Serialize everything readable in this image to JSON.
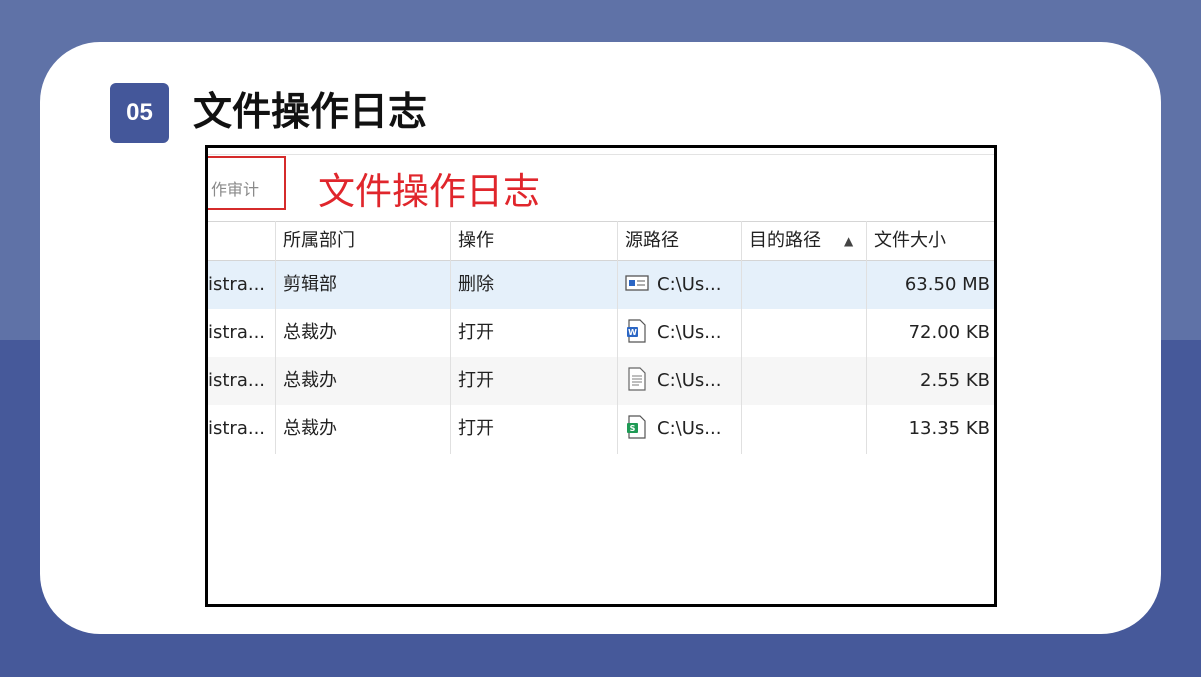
{
  "slide": {
    "badge": "05",
    "title": "文件操作日志"
  },
  "window": {
    "tab_label": "作审计",
    "annotation": "文件操作日志",
    "columns": [
      {
        "key": "user",
        "label": ""
      },
      {
        "key": "dept",
        "label": "所属部门"
      },
      {
        "key": "op",
        "label": "操作"
      },
      {
        "key": "src",
        "label": "源路径"
      },
      {
        "key": "dst",
        "label": "目的路径"
      },
      {
        "key": "size",
        "label": "文件大小"
      }
    ],
    "sort_indicator": "▲",
    "rows": [
      {
        "user": "istra...",
        "dept": "剪辑部",
        "op": "删除",
        "src": "C:\\Us...",
        "dst": "",
        "size": "63.50 MB",
        "icon": "media-file-icon"
      },
      {
        "user": "istra...",
        "dept": "总裁办",
        "op": "打开",
        "src": "C:\\Us...",
        "dst": "",
        "size": "72.00 KB",
        "icon": "word-file-icon"
      },
      {
        "user": "istra...",
        "dept": "总裁办",
        "op": "打开",
        "src": "C:\\Us...",
        "dst": "",
        "size": "2.55 KB",
        "icon": "text-file-icon"
      },
      {
        "user": "istra...",
        "dept": "总裁办",
        "op": "打开",
        "src": "C:\\Us...",
        "dst": "",
        "size": "13.35 KB",
        "icon": "spreadsheet-file-icon"
      }
    ],
    "colors": {
      "selected_row": "#e5f0fa",
      "alt_row": "#f6f6f6",
      "annotation_red": "#e0262c",
      "word_blue": "#2b66c4",
      "sheet_green": "#1f9a55"
    }
  }
}
